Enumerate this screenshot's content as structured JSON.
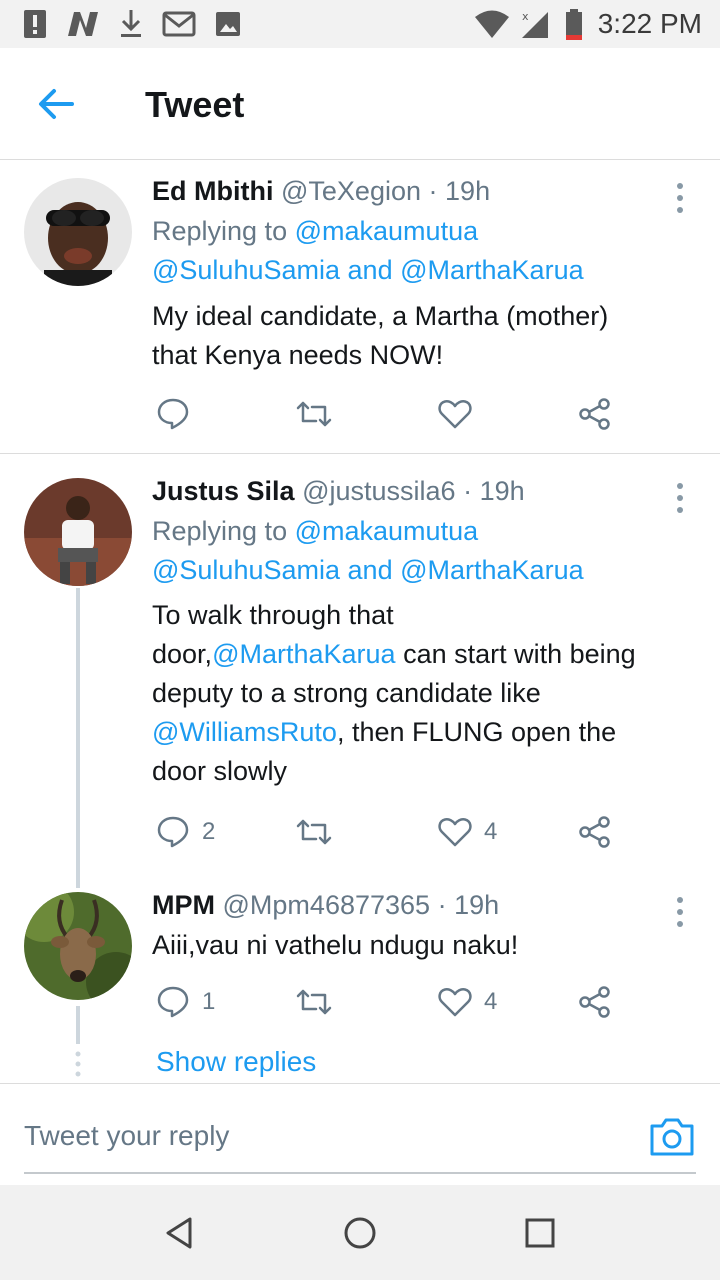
{
  "status_bar": {
    "time": "3:22 PM"
  },
  "app_bar": {
    "title": "Tweet"
  },
  "tweets": [
    {
      "name": "Ed Mbithi",
      "handle": "@TeXegion",
      "sep": "·",
      "time": "19h",
      "replying_prefix": "Replying to",
      "reply_to_1": "@makaumutua",
      "reply_to_2": "@SuluhuSamia",
      "reply_and": "and",
      "reply_to_3": "@MarthaKarua",
      "text_line1": "My ideal candidate, a Martha (mother)",
      "text_line2": "that Kenya needs NOW!",
      "replies": "",
      "likes": ""
    },
    {
      "name": "Justus Sila",
      "handle": "@justussila6",
      "sep": "·",
      "time": "19h",
      "replying_prefix": "Replying to",
      "reply_to_1": "@makaumutua",
      "reply_to_2": "@SuluhuSamia",
      "reply_and": "and",
      "reply_to_3": "@MarthaKarua",
      "text_line1": "To walk through that",
      "text_line2_a": "door,",
      "text_line2_mention": "@MarthaKarua",
      "text_line2_b": " can start with being",
      "text_line3": "deputy to a strong candidate like",
      "text_line4_mention": "@WilliamsRuto",
      "text_line4_b": ", then FLUNG open the",
      "text_line5": "door slowly",
      "replies": "2",
      "likes": "4"
    },
    {
      "name": "MPM",
      "handle": "@Mpm46877365",
      "sep": "·",
      "time": "19h",
      "text_line1": "Aiii,vau ni vathelu ndugu naku!",
      "replies": "1",
      "likes": "4"
    }
  ],
  "show_replies": "Show replies",
  "reply_box": {
    "placeholder": "Tweet your reply"
  },
  "colors": {
    "accent": "#1d9bf0",
    "text": "#14171a",
    "muted": "#657786"
  }
}
